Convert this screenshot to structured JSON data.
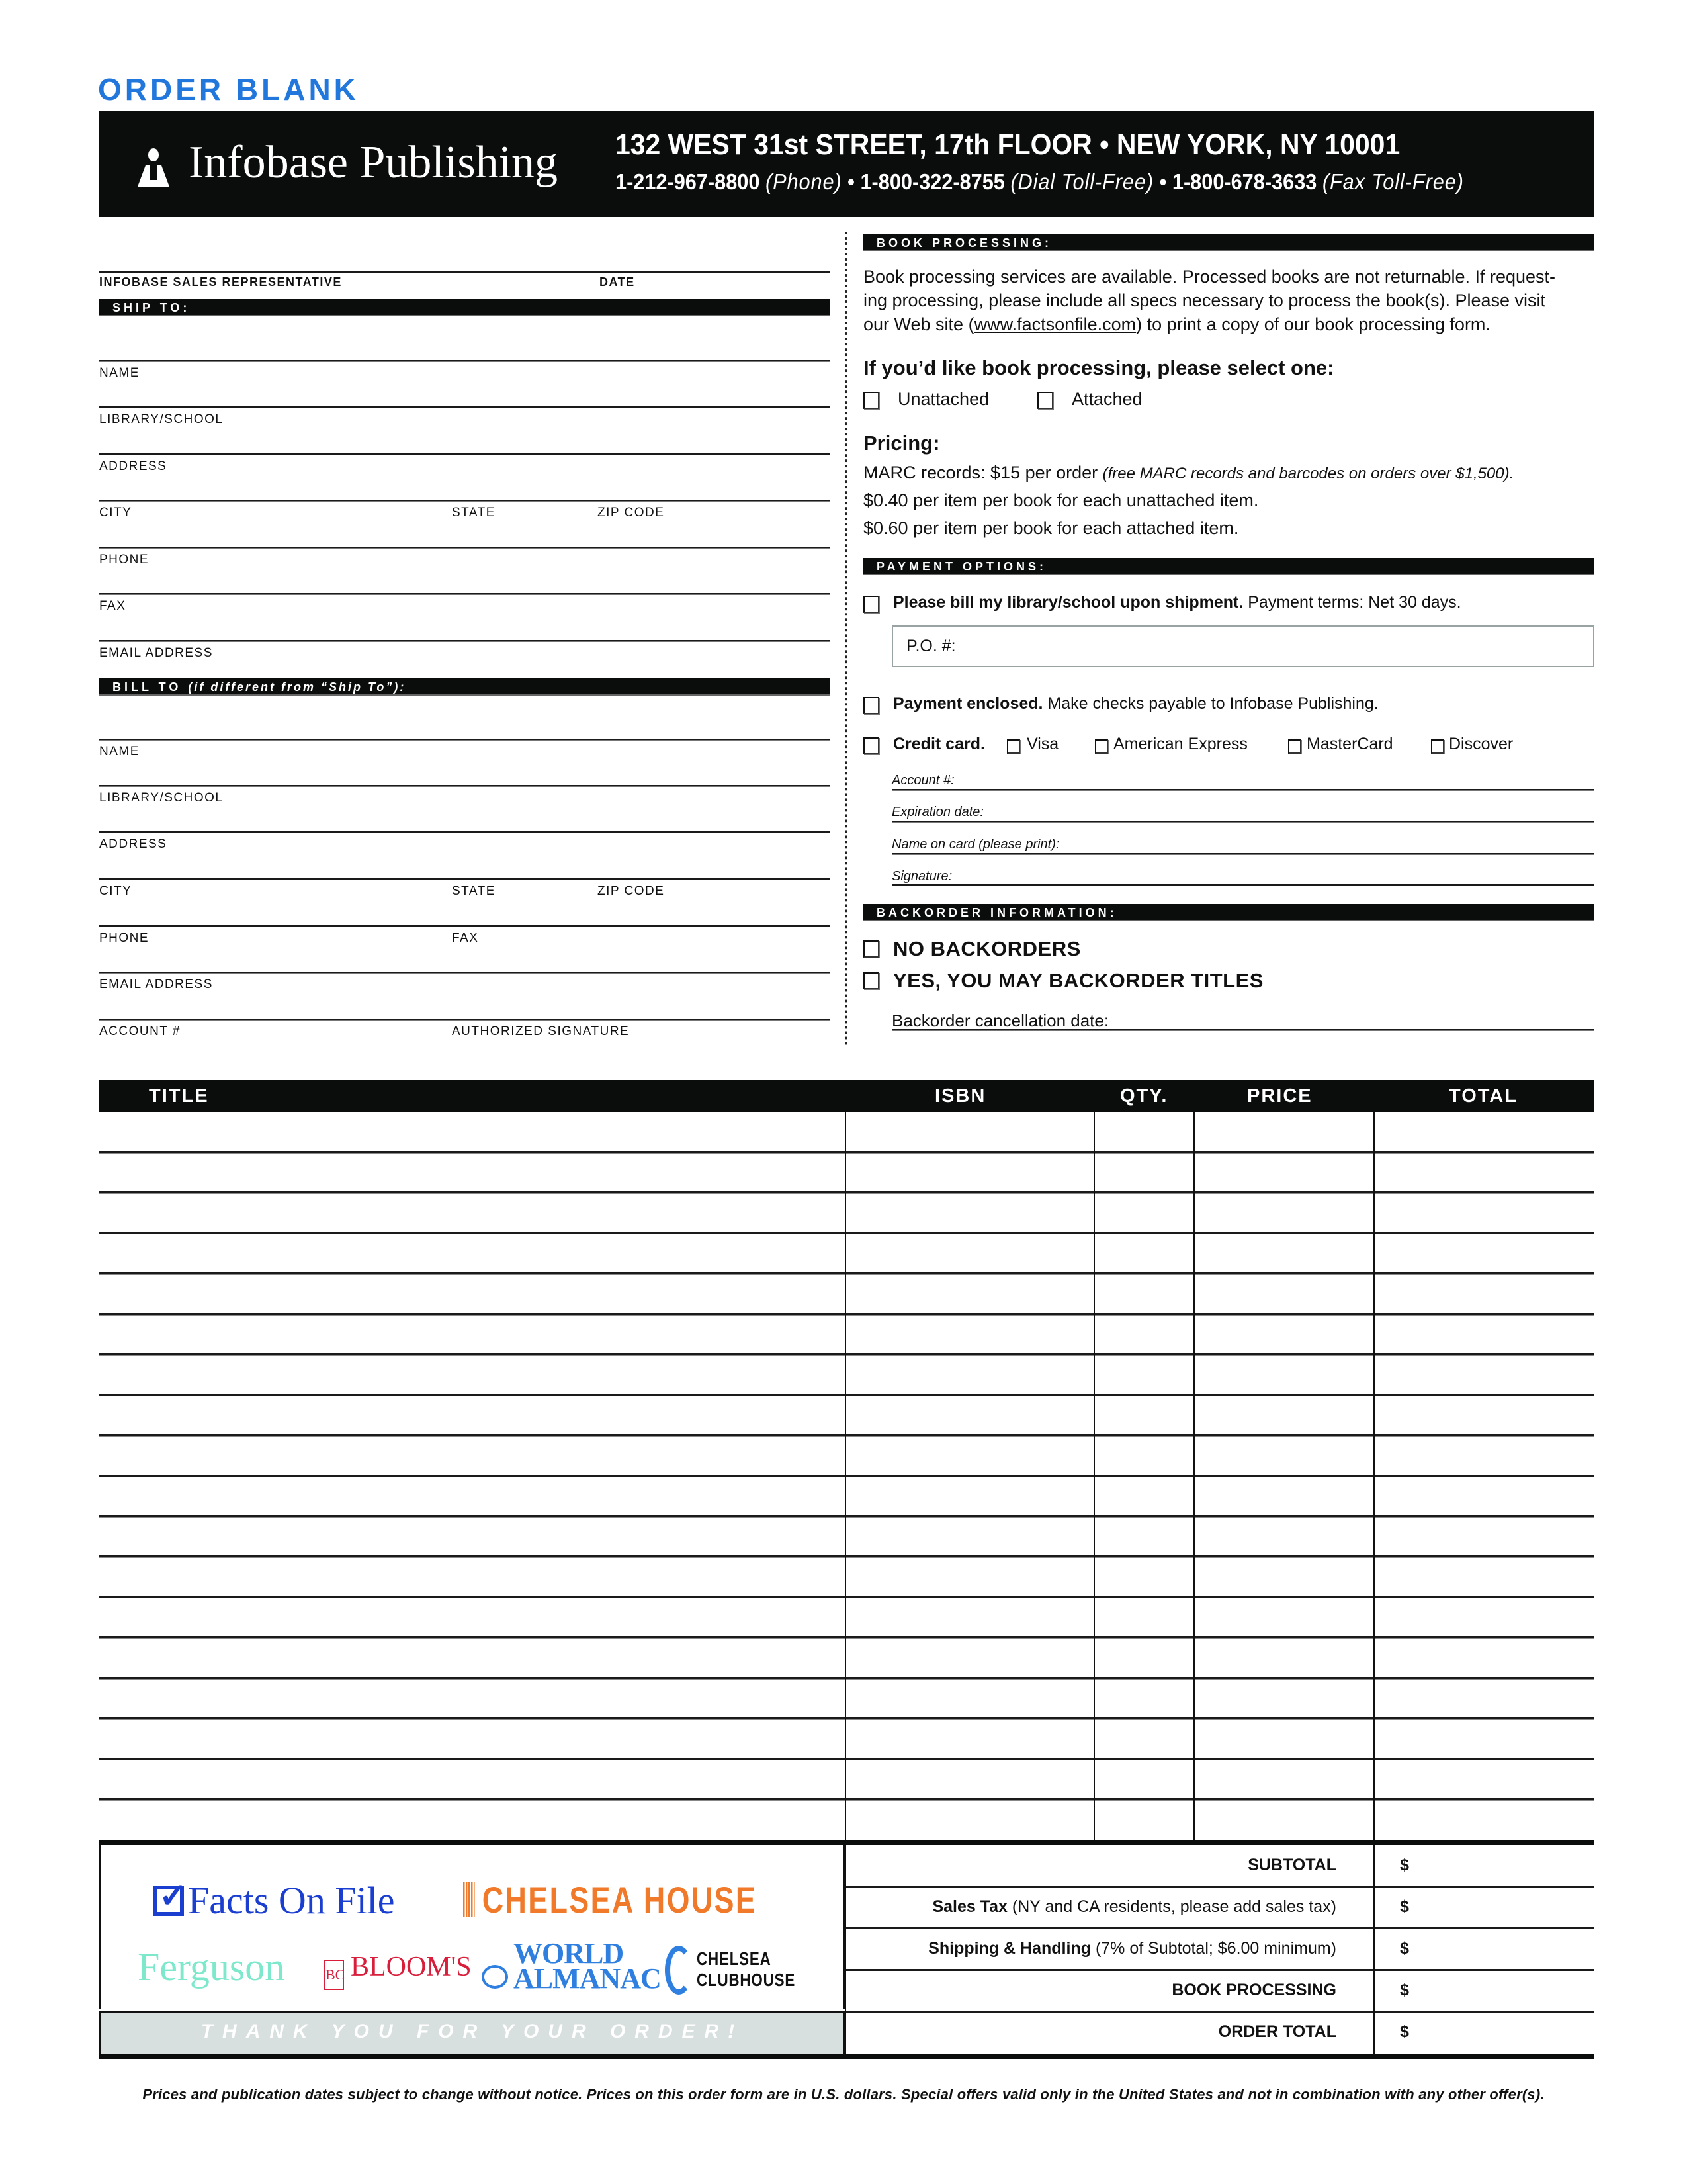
{
  "title": "ORDER BLANK",
  "colors": {
    "title_blue": "#2277dd",
    "bar_black": "#0b0c0c",
    "thanks_gray": "#d8dfdf"
  },
  "header": {
    "logo_icon": "infobase-person-icon",
    "logo_text": "Infobase Publishing",
    "address": "132 WEST 31st STREET, 17th FLOOR • NEW YORK, NY 10001",
    "phones": [
      {
        "number": "1-212-967-8800",
        "note": "(Phone)"
      },
      {
        "number": "1-800-322-8755",
        "note": "(Dial Toll-Free)"
      },
      {
        "number": "1-800-678-3633",
        "note": "(Fax Toll-Free)"
      }
    ],
    "separator": "•"
  },
  "rep": {
    "rep_label": "INFOBASE SALES REPRESENTATIVE",
    "date_label": "DATE"
  },
  "ship_to": {
    "heading": "SHIP TO:",
    "fields": {
      "name": "NAME",
      "library": "LIBRARY/SCHOOL",
      "address": "ADDRESS",
      "city": "CITY",
      "state": "STATE",
      "zip": "ZIP CODE",
      "phone": "PHONE",
      "fax": "FAX",
      "email": "EMAIL ADDRESS"
    }
  },
  "bill_to": {
    "heading": "BILL TO",
    "heading_note": "(if different from “Ship To”):",
    "fields": {
      "name": "NAME",
      "library": "LIBRARY/SCHOOL",
      "address": "ADDRESS",
      "city": "CITY",
      "state": "STATE",
      "zip": "ZIP CODE",
      "phone": "PHONE",
      "fax": "FAX",
      "email": "EMAIL ADDRESS",
      "account": "ACCOUNT #",
      "signature": "AUTHORIZED SIGNATURE"
    }
  },
  "book_processing": {
    "heading": "BOOK PROCESSING:",
    "text_1": "Book processing services are available. Processed books are not returnable. If request-",
    "text_2": "ing processing, please include all specs necessary to process the book(s). Please visit",
    "text_3_before": "our Web site (",
    "link": "www.factsonfile.com",
    "text_3_after": ") to print a copy of our book processing form.",
    "select_heading": "If you’d like book processing, please select one:",
    "options": [
      "Unattached",
      "Attached"
    ],
    "pricing_heading": "Pricing:",
    "pricing_1": "MARC records: $15 per order ",
    "pricing_1_note": "(free MARC records and barcodes on orders over $1,500).",
    "pricing_2": "$0.40 per item per book for each unattached item.",
    "pricing_3": "$0.60 per item per book for each attached item."
  },
  "payment": {
    "heading": "PAYMENT OPTIONS:",
    "bill_bold": "Please bill my library/school upon shipment.",
    "bill_rest": " Payment terms: Net 30 days.",
    "po_label": "P.O. #:",
    "enclosed_bold": "Payment enclosed.",
    "enclosed_rest": " Make checks payable to Infobase Publishing.",
    "credit_bold": "Credit card.",
    "cards": [
      "Visa",
      "American Express",
      "MasterCard",
      "Discover"
    ],
    "card_fields": [
      "Account #:",
      "Expiration date:",
      "Name on card (please print):",
      "Signature:"
    ]
  },
  "backorder": {
    "heading": "BACKORDER INFORMATION:",
    "options": [
      "NO BACKORDERS",
      "YES, YOU MAY BACKORDER TITLES"
    ],
    "cancel_label": "Backorder cancellation date:"
  },
  "order_table": {
    "columns": [
      "TITLE",
      "ISBN",
      "QTY.",
      "PRICE",
      "TOTAL"
    ],
    "row_count": 18
  },
  "totals": [
    {
      "bold": "SUBTOTAL",
      "rest": "",
      "currency": "$"
    },
    {
      "bold": "Sales Tax",
      "rest": " (NY and CA residents, please add sales tax)",
      "currency": "$"
    },
    {
      "bold": "Shipping & Handling",
      "rest": " (7% of Subtotal; $6.00 minimum)",
      "currency": "$"
    },
    {
      "bold": "BOOK PROCESSING",
      "rest": "",
      "currency": "$"
    },
    {
      "bold": "ORDER TOTAL",
      "rest": "",
      "currency": "$"
    }
  ],
  "logos": {
    "facts_on_file": "Facts On File",
    "chelsea_house": "CHELSEA HOUSE",
    "ferguson": "Ferguson",
    "blooms": "BLOOM'S",
    "blooms_mark": "BC",
    "world_almanac_1": "WORLD",
    "world_almanac_2": "ALMANAC",
    "clubhouse_1": "CHELSEA",
    "clubhouse_2": "CLUBHOUSE"
  },
  "thanks": "THANK YOU FOR YOUR ORDER!",
  "footer_note": "Prices and publication dates subject to change without notice. Prices on this order form are in U.S. dollars. Special offers valid only in the United States and not in combination with any other offer(s)."
}
